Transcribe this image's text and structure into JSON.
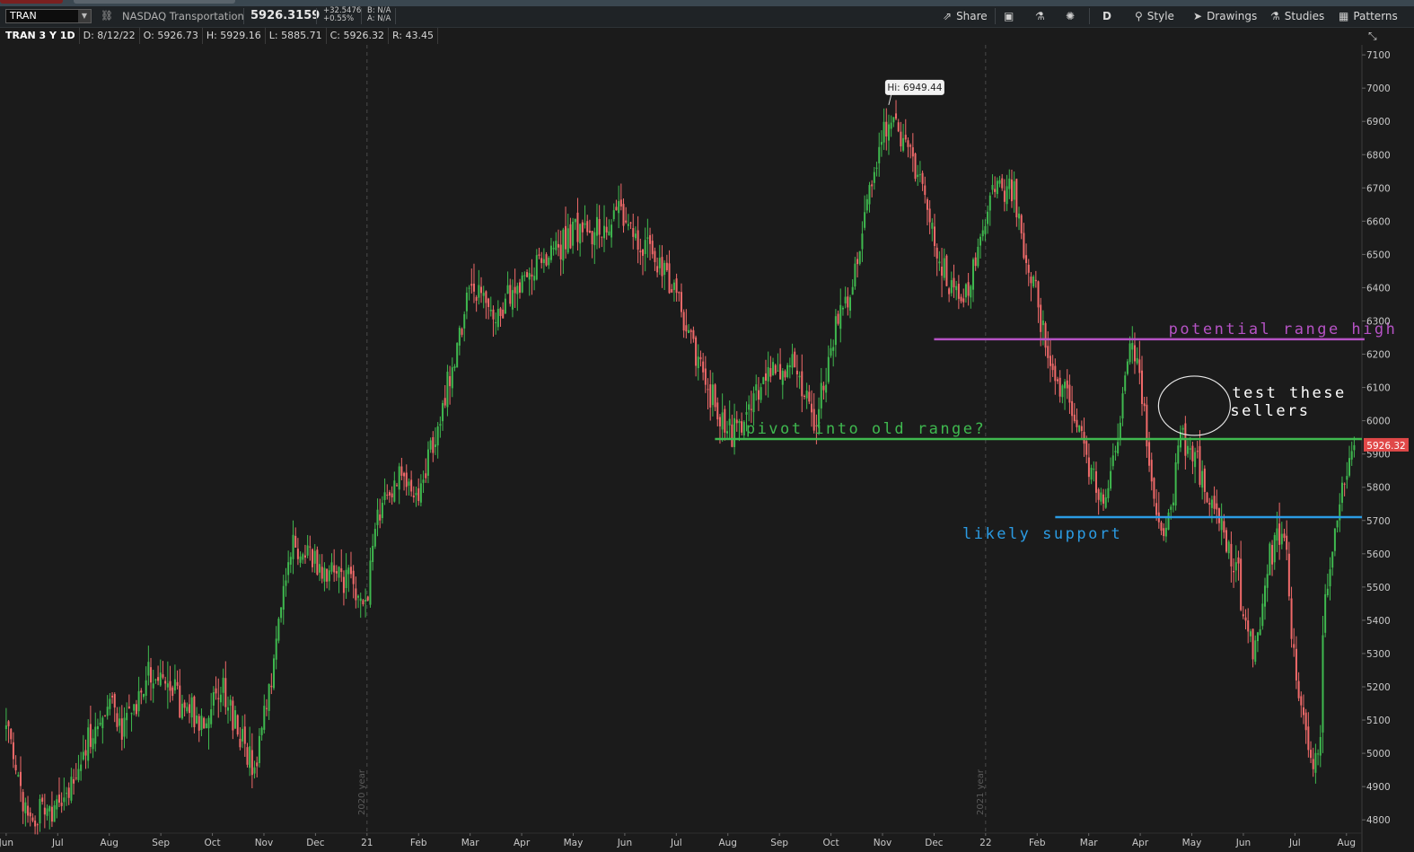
{
  "toolbar": {
    "symbol": "TRAN",
    "description": "NASDAQ Transportation",
    "last_price": "5926.3159",
    "net_change": "+32.5476",
    "pct_change": "+0.55%",
    "bid": "B: N/A",
    "ask": "A: N/A",
    "share": "Share",
    "aggregation": "D",
    "style": "Style",
    "drawings": "Drawings",
    "studies": "Studies",
    "patterns": "Patterns"
  },
  "infobar": {
    "title": "TRAN 3 Y 1D",
    "date": "D: 8/12/22",
    "open": "O: 5926.73",
    "high": "H: 5929.16",
    "low": "L: 5885.71",
    "close": "C: 5926.32",
    "range": "R: 43.45"
  },
  "colors": {
    "up": "#3fb94f",
    "down": "#f06a6a",
    "background": "#1b1b1b",
    "range_high": "#b552c4",
    "pivot": "#3fb94f",
    "support": "#2b9be3",
    "price_tag": "#e04848"
  },
  "chart_data": {
    "type": "candlestick",
    "title": "TRAN 3 Y 1D",
    "ylim": [
      4760,
      7130
    ],
    "y_ticks": [
      4800,
      4900,
      5000,
      5100,
      5200,
      5300,
      5400,
      5500,
      5600,
      5700,
      5800,
      5900,
      6000,
      6100,
      6200,
      6300,
      6400,
      6500,
      6600,
      6700,
      6800,
      6900,
      7000,
      7100
    ],
    "x_ticks": [
      "Jun",
      "Jul",
      "Aug",
      "Sep",
      "Oct",
      "Nov",
      "Dec",
      "21",
      "Feb",
      "Mar",
      "Apr",
      "May",
      "Jun",
      "Jul",
      "Aug",
      "Sep",
      "Oct",
      "Nov",
      "Dec",
      "22",
      "Feb",
      "Mar",
      "Apr",
      "May",
      "Jun",
      "Jul",
      "Aug"
    ],
    "x_tick_months": [
      0,
      1,
      2,
      3,
      4,
      5,
      6,
      7,
      8,
      9,
      10,
      11,
      12,
      13,
      14,
      15,
      16,
      17,
      18,
      19,
      20,
      21,
      22,
      23,
      24,
      25,
      26
    ],
    "x_range_months": [
      -0.05,
      26.3
    ],
    "year_lines": [
      {
        "month": 7,
        "label": "2020 year"
      },
      {
        "month": 19,
        "label": "2021 year"
      }
    ],
    "price_path_months": [
      0,
      0.3,
      0.55,
      0.7,
      1.0,
      1.5,
      2.0,
      2.3,
      2.8,
      3.4,
      3.8,
      4.2,
      4.8,
      5.3,
      5.5,
      6.0,
      6.6,
      7.0,
      7.2,
      7.6,
      8.0,
      8.5,
      9.0,
      9.5,
      10.0,
      10.5,
      11.0,
      11.3,
      11.9,
      12.4,
      12.9,
      13.2,
      13.8,
      14.1,
      14.6,
      15.2,
      15.7,
      16.0,
      16.5,
      17.0,
      17.2,
      17.5,
      17.8,
      18.3,
      18.6,
      18.9,
      19.2,
      19.5,
      19.9,
      20.2,
      20.6,
      21.0,
      21.3,
      21.6,
      21.8,
      22.0,
      22.2,
      22.5,
      22.8,
      23.1,
      23.4,
      23.9,
      24.2,
      24.5,
      24.8,
      25.0,
      25.3,
      25.6,
      25.9,
      26.15
    ],
    "price_path_values": [
      5080,
      4850,
      4780,
      4840,
      4820,
      5010,
      5180,
      5060,
      5250,
      5140,
      5090,
      5200,
      4940,
      5380,
      5620,
      5580,
      5510,
      5470,
      5710,
      5820,
      5760,
      6080,
      6380,
      6330,
      6420,
      6500,
      6570,
      6550,
      6620,
      6520,
      6420,
      6290,
      6030,
      5960,
      6100,
      6200,
      6000,
      6200,
      6500,
      6850,
      6900,
      6810,
      6680,
      6400,
      6350,
      6570,
      6700,
      6700,
      6430,
      6200,
      6060,
      5860,
      5760,
      5980,
      6250,
      6160,
      5820,
      5640,
      5950,
      5880,
      5740,
      5520,
      5290,
      5600,
      5670,
      5240,
      4960,
      5060,
      4940,
      5100
    ],
    "close_tail_months": [
      25.5,
      25.8,
      26.15
    ],
    "close_tail_values": [
      5350,
      5700,
      5926.32
    ],
    "high_label": "Hi: 6949.44",
    "high_value": 6949.44,
    "high_month": 17.12,
    "last_close": "5926.32",
    "last_close_value": 5926.32,
    "annotations": [
      {
        "text": "potential range high",
        "color": "#b552c4",
        "value": 6245,
        "from_month": 18.0,
        "to_month": 26.35,
        "text_month": 22.55
      },
      {
        "text": "pivot into old range?",
        "color": "#3fb94f",
        "value": 5945,
        "from_month": 13.75,
        "to_month": 26.3,
        "text_month": 14.35
      },
      {
        "text": "likely support",
        "color": "#2b9be3",
        "value": 5710,
        "from_month": 20.35,
        "to_month": 26.3,
        "text_month": 18.55
      },
      {
        "text": "test these\nsellers",
        "color": "#ffffff",
        "circle_month": 23.05,
        "circle_value": 6045
      }
    ]
  }
}
